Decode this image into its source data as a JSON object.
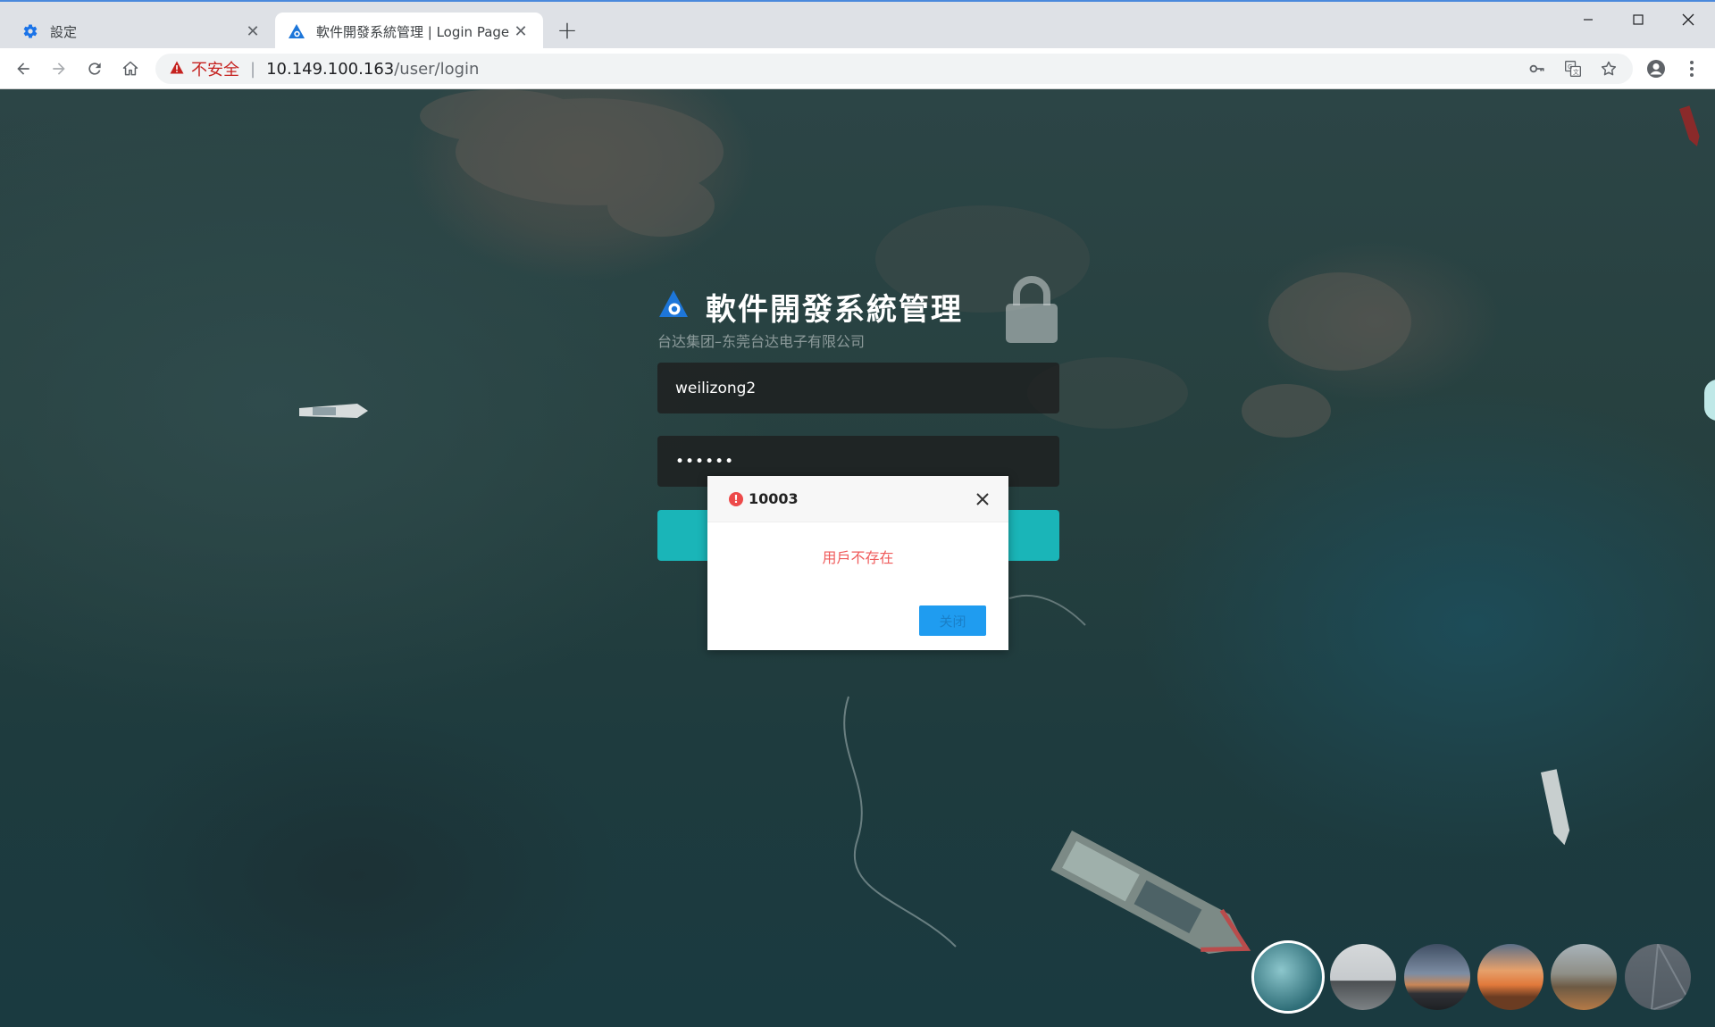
{
  "browser": {
    "tabs": [
      {
        "title": "設定",
        "icon": "gear-icon",
        "active": false
      },
      {
        "title": "軟件開發系統管理 | Login Page",
        "icon": "app-logo-icon",
        "active": true
      }
    ],
    "address_bar": {
      "security_label": "不安全",
      "url_host": "10.149.100.163",
      "url_path": "/user/login"
    }
  },
  "login": {
    "system_title": "軟件開發系統管理",
    "company": "台达集团–东莞台达电子有限公司",
    "username_value": "weilizong2",
    "password_mask": "••••••",
    "accent_color": "#1ab5b8"
  },
  "dialog": {
    "title": "10003",
    "message": "用戶不存在",
    "button_label": "关闭",
    "message_color": "#ef5a5a",
    "button_color": "#1f9cf0"
  },
  "backgrounds": {
    "count": 6,
    "selected_index": 0
  }
}
